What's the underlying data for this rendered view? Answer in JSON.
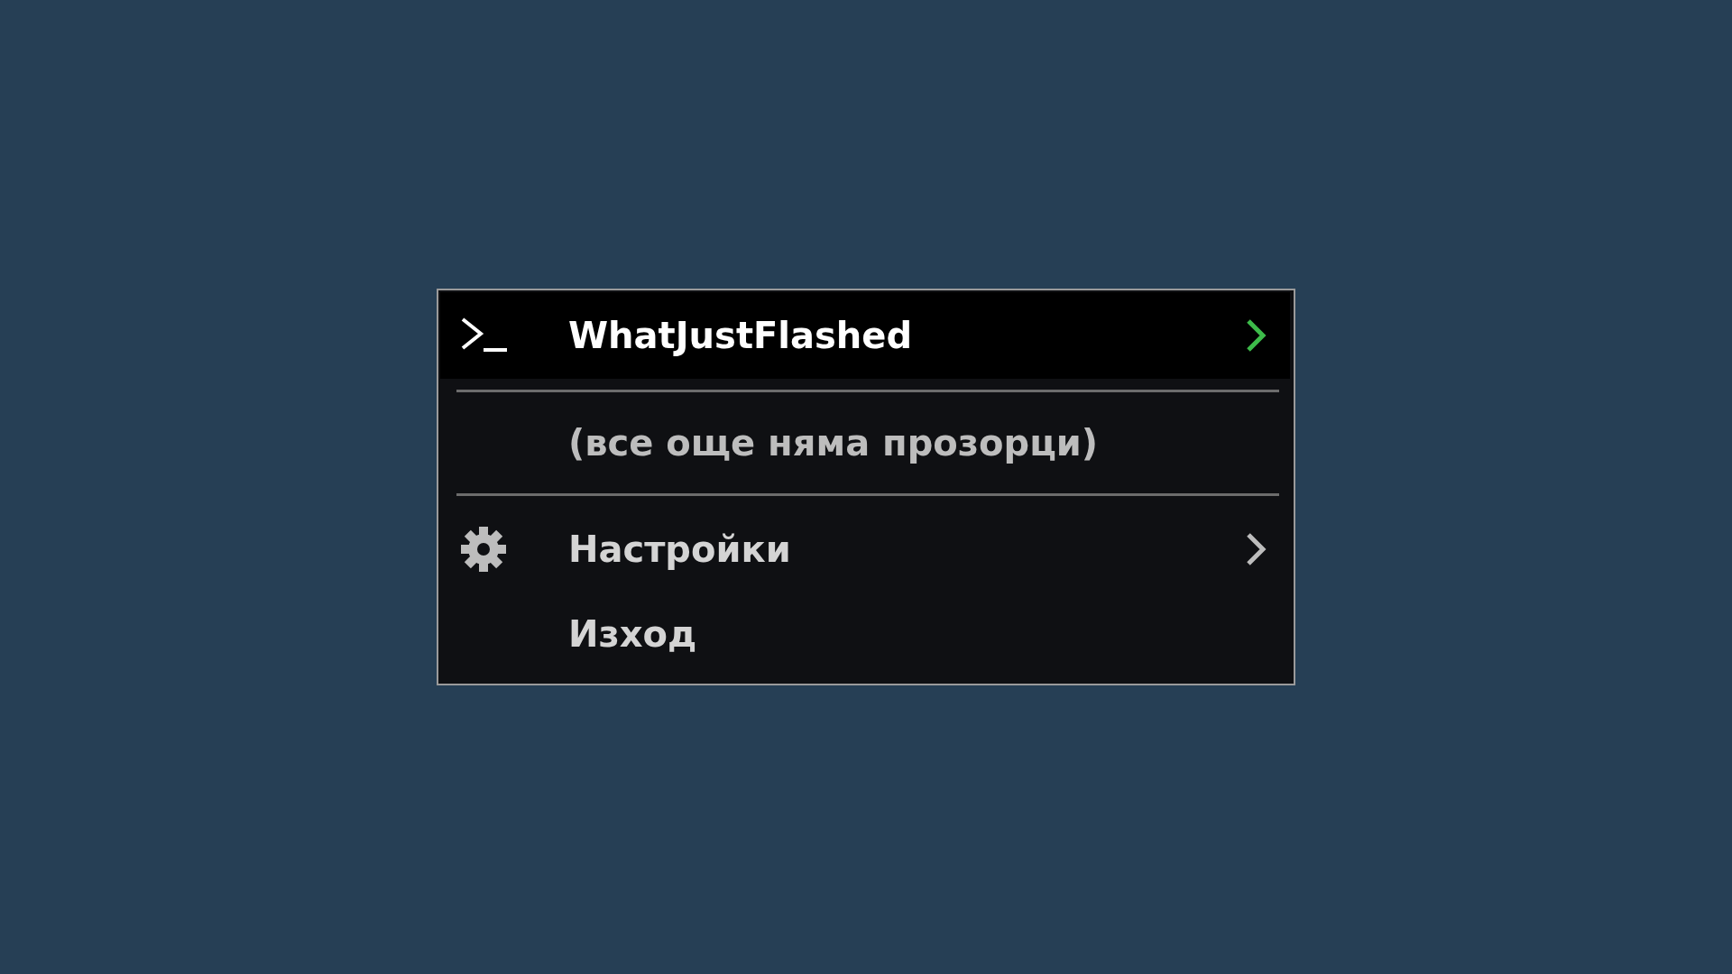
{
  "menu": {
    "items": [
      {
        "kind": "title",
        "label": "WhatJustFlashed"
      },
      {
        "kind": "separator"
      },
      {
        "kind": "placeholder",
        "label": "(все още няма прозорци)"
      },
      {
        "kind": "separator"
      },
      {
        "kind": "submenu",
        "label": "Настройки"
      },
      {
        "kind": "action",
        "label": "Изход"
      }
    ]
  }
}
